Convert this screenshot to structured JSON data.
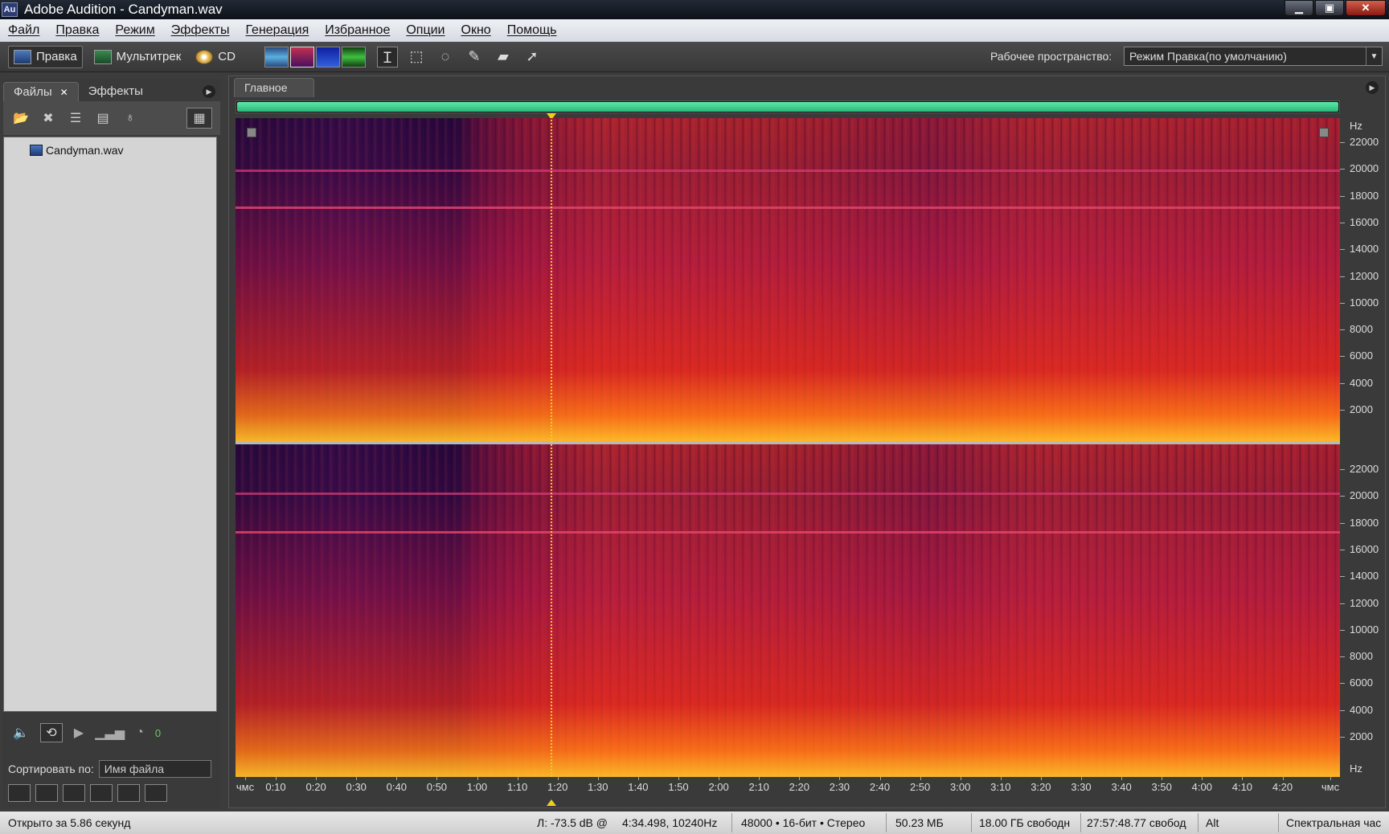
{
  "window": {
    "title": "Adobe Audition - Candyman.wav",
    "icon_text": "Au"
  },
  "menu": [
    "Файл",
    "Правка",
    "Режим",
    "Эффекты",
    "Генерация",
    "Избранное",
    "Опции",
    "Окно",
    "Помощь"
  ],
  "toolbar": {
    "modes": [
      {
        "label": "Правка",
        "icon": "edit-view-icon"
      },
      {
        "label": "Мультитрек",
        "icon": "multitrack-icon"
      },
      {
        "label": "CD",
        "icon": "cd-icon"
      }
    ],
    "workspace_label": "Рабочее пространство:",
    "workspace_value": "Режим Правка(по умолчанию)"
  },
  "left_panel": {
    "tabs": [
      "Файлы",
      "Эффекты"
    ],
    "files": [
      "Candyman.wav"
    ],
    "volume_value": "0",
    "sort_label": "Сортировать по:",
    "sort_value": "Имя файла"
  },
  "main_panel": {
    "tab": "Главное",
    "hz_unit": "Hz",
    "hz_labels_top": [
      "22000",
      "20000",
      "18000",
      "16000",
      "14000",
      "12000",
      "10000",
      "8000",
      "6000",
      "4000",
      "2000"
    ],
    "hz_labels_bottom": [
      "22000",
      "20000",
      "18000",
      "16000",
      "14000",
      "12000",
      "10000",
      "8000",
      "6000",
      "4000",
      "2000"
    ],
    "time_labels": [
      "чмс",
      "0:10",
      "0:20",
      "0:30",
      "0:40",
      "0:50",
      "1:00",
      "1:10",
      "1:20",
      "1:30",
      "1:40",
      "1:50",
      "2:00",
      "2:10",
      "2:20",
      "2:30",
      "2:40",
      "2:50",
      "3:00",
      "3:10",
      "3:20",
      "3:30",
      "3:40",
      "3:50",
      "4:00",
      "4:10",
      "4:20",
      "чмс"
    ],
    "cursor_time": "1:20"
  },
  "status": {
    "opened": "Открыто за 5.86 секунд",
    "level": "Л: -73.5 dB @",
    "position": "4:34.498, 10240Hz",
    "format": "48000 • 16-бит • Стерео",
    "size": "50.23 МБ",
    "free_space": "18.00 ГБ свободн",
    "free_time": "27:57:48.77 свобод",
    "key": "Alt",
    "view": "Спектральная час"
  }
}
